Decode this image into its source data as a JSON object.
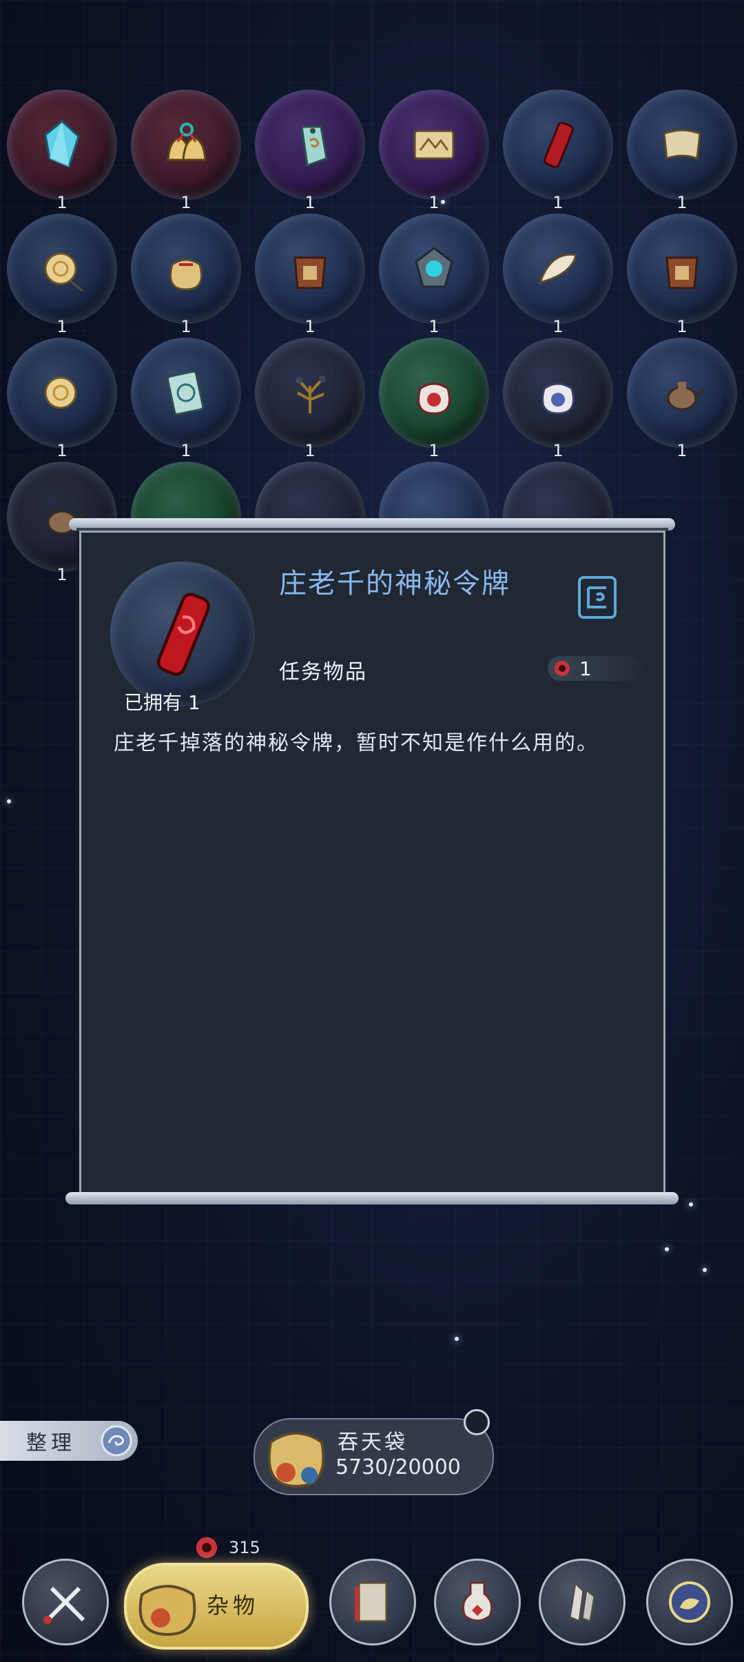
{
  "inventory": {
    "rows": [
      {
        "counts": [
          "1",
          "1",
          "1",
          "1",
          "1",
          "1"
        ]
      },
      {
        "counts": [
          "1",
          "1",
          "1",
          "1",
          "1",
          "1"
        ]
      },
      {
        "counts": [
          "1",
          "1",
          "1",
          "1",
          "1",
          "1"
        ]
      },
      {
        "counts": [
          "1"
        ]
      }
    ]
  },
  "detail": {
    "title": "庄老千的神秘令牌",
    "category": "任务物品",
    "owned": "已拥有 1",
    "value": "1",
    "description": "庄老千掉落的神秘令牌，暂时不知是作什么用的。"
  },
  "bottom": {
    "sort_label": "整理",
    "bag_name": "吞天袋",
    "bag_capacity": "5730/20000",
    "currency": "315",
    "active_tab_label": "杂物"
  },
  "icons": {
    "seal": "seal-icon",
    "coin": "red-coin-icon",
    "sort": "swirl-icon"
  },
  "colors": {
    "title": "#8bb8f0",
    "panel_bg": "#202833",
    "active_tab": "#e8d88a"
  }
}
